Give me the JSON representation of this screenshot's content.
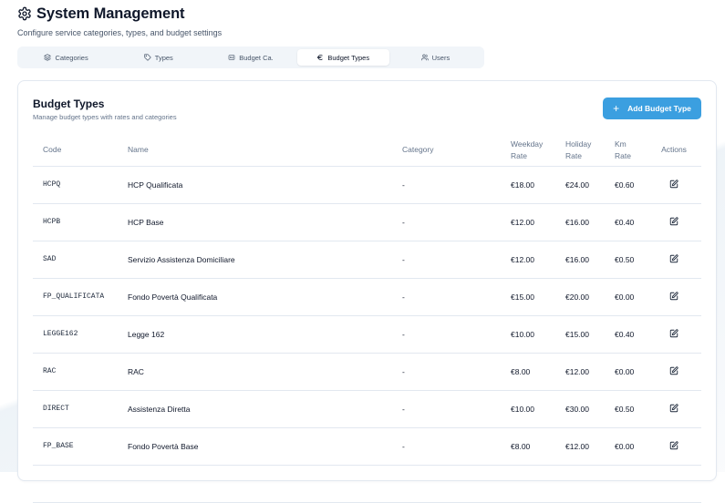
{
  "header": {
    "title": "System Management",
    "subtitle": "Configure service categories, types, and budget settings"
  },
  "tabs": [
    {
      "label": "Categories",
      "icon": "layers-icon",
      "active": false
    },
    {
      "label": "Types",
      "icon": "tag-icon",
      "active": false
    },
    {
      "label": "Budget Ca.",
      "icon": "receipt-icon",
      "active": false
    },
    {
      "label": "Budget Types",
      "icon": "euro-icon",
      "active": true
    },
    {
      "label": "Users",
      "icon": "users-icon",
      "active": false
    }
  ],
  "card": {
    "title": "Budget Types",
    "description": "Manage budget types with rates and categories",
    "add_button_label": "Add Budget Type"
  },
  "table": {
    "headers": {
      "code": "Code",
      "name": "Name",
      "category": "Category",
      "weekday_rate": [
        "Weekday",
        "Rate"
      ],
      "holiday_rate": [
        "Holiday",
        "Rate"
      ],
      "km_rate": [
        "Km",
        "Rate"
      ],
      "actions": "Actions"
    },
    "rows": [
      {
        "code": "HCPQ",
        "name": "HCP Qualificata",
        "category": "-",
        "weekday": "€18.00",
        "holiday": "€24.00",
        "km": "€0.60"
      },
      {
        "code": "HCPB",
        "name": "HCP Base",
        "category": "-",
        "weekday": "€12.00",
        "holiday": "€16.00",
        "km": "€0.40"
      },
      {
        "code": "SAD",
        "name": "Servizio Assistenza Domiciliare",
        "category": "-",
        "weekday": "€12.00",
        "holiday": "€16.00",
        "km": "€0.50"
      },
      {
        "code": "FP_QUALIFICATA",
        "name": "Fondo Povertà Qualificata",
        "category": "-",
        "weekday": "€15.00",
        "holiday": "€20.00",
        "km": "€0.00"
      },
      {
        "code": "LEGGE162",
        "name": "Legge 162",
        "category": "-",
        "weekday": "€10.00",
        "holiday": "€15.00",
        "km": "€0.40"
      },
      {
        "code": "RAC",
        "name": "RAC",
        "category": "-",
        "weekday": "€8.00",
        "holiday": "€12.00",
        "km": "€0.00"
      },
      {
        "code": "DIRECT",
        "name": "Assistenza Diretta",
        "category": "-",
        "weekday": "€10.00",
        "holiday": "€30.00",
        "km": "€0.50"
      },
      {
        "code": "FP_BASE",
        "name": "Fondo Povertà Base",
        "category": "-",
        "weekday": "€8.00",
        "holiday": "€12.00",
        "km": "€0.00"
      },
      {
        "code": "",
        "name": "",
        "category": "",
        "weekday": "",
        "holiday": "",
        "km": ""
      }
    ]
  },
  "colors": {
    "accent": "#3b9fe0",
    "tab_bg": "#f1f5f9",
    "border": "#e2e8f0",
    "muted_text": "#64748b"
  }
}
